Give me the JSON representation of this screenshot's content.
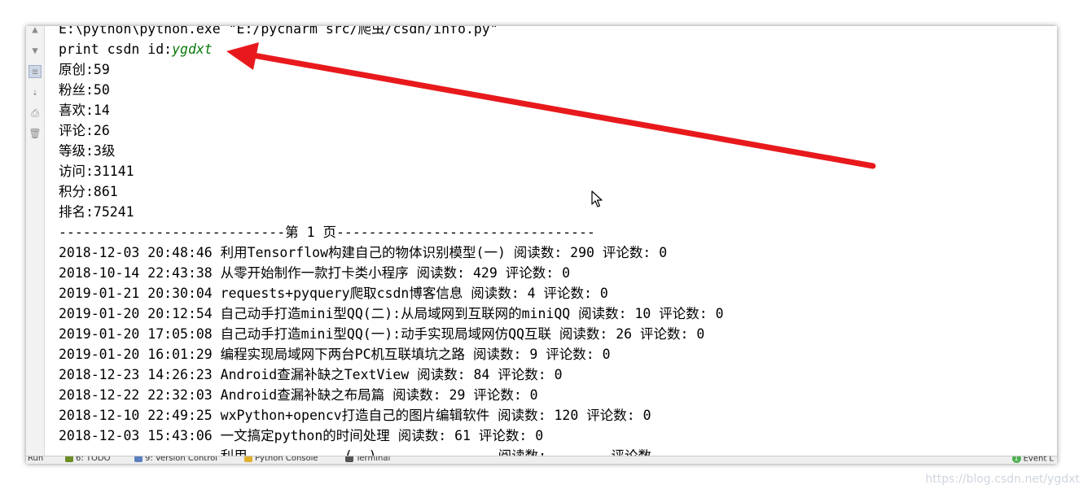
{
  "gutter": {
    "icons": [
      "up-arrow-icon",
      "down-arrow-icon",
      "soft-wrap-icon",
      "scroll-to-end-icon",
      "print-icon",
      "trash-icon"
    ]
  },
  "console": {
    "lines": [
      {
        "text": "E:\\python\\python.exe \"E:/pycharm src/爬虫/csdn/info.py\""
      },
      {
        "prefix": "print csdn id:",
        "value": "ygdxt"
      },
      {
        "text": "原创:59"
      },
      {
        "text": "粉丝:50"
      },
      {
        "text": "喜欢:14"
      },
      {
        "text": "评论:26"
      },
      {
        "text": "等级:3级"
      },
      {
        "text": "访问:31141"
      },
      {
        "text": "积分:861"
      },
      {
        "text": "排名:75241"
      },
      {
        "text": "----------------------------第 1 页--------------------------------"
      },
      {
        "text": "2018-12-03 20:48:46 利用Tensorflow构建自己的物体识别模型(一) 阅读数: 290 评论数: 0"
      },
      {
        "text": "2018-10-14 22:43:38 从零开始制作一款打卡类小程序 阅读数: 429 评论数: 0"
      },
      {
        "text": "2019-01-21 20:30:04 requests+pyquery爬取csdn博客信息 阅读数: 4 评论数: 0"
      },
      {
        "text": "2019-01-20 20:12:54 自己动手打造mini型QQ(二):从局域网到互联网的miniQQ 阅读数: 10 评论数: 0"
      },
      {
        "text": "2019-01-20 17:05:08 自己动手打造mini型QQ(一):动手实现局域网仿QQ互联 阅读数: 26 评论数: 0"
      },
      {
        "text": "2019-01-20 16:01:29 编程实现局域网下两台PC机互联填坑之路 阅读数: 9 评论数: 0"
      },
      {
        "text": "2018-12-23 14:26:23 Android查漏补缺之TextView 阅读数: 84 评论数: 0"
      },
      {
        "text": "2018-12-22 22:32:03 Android查漏补缺之布局篇 阅读数: 29 评论数: 0"
      },
      {
        "text": "2018-12-10 22:49:25 wxPython+opencv打造自己的图片编辑软件 阅读数: 120 评论数: 0"
      },
      {
        "text": "2018-12-03 15:43:06 一文搞定python的时间处理 阅读数: 61 评论数: 0"
      },
      {
        "text": "                    利用            (  )               阅读数:        评论数"
      }
    ]
  },
  "statusbar": {
    "tabs": [
      {
        "label": "Run",
        "icon": "run-icon"
      },
      {
        "label": "6: TODO",
        "icon": "todo-icon"
      },
      {
        "label": "9: Version Control",
        "icon": "version-control-icon"
      },
      {
        "label": "Python Console",
        "icon": "python-console-icon"
      },
      {
        "label": "Terminal",
        "icon": "terminal-icon"
      }
    ],
    "event_count": "1",
    "event_label": "Event L"
  },
  "watermark": "https://blog.csdn.net/ygdxt",
  "colors": {
    "arrow": "#e8191c",
    "green_text": "#0a7a0a"
  }
}
